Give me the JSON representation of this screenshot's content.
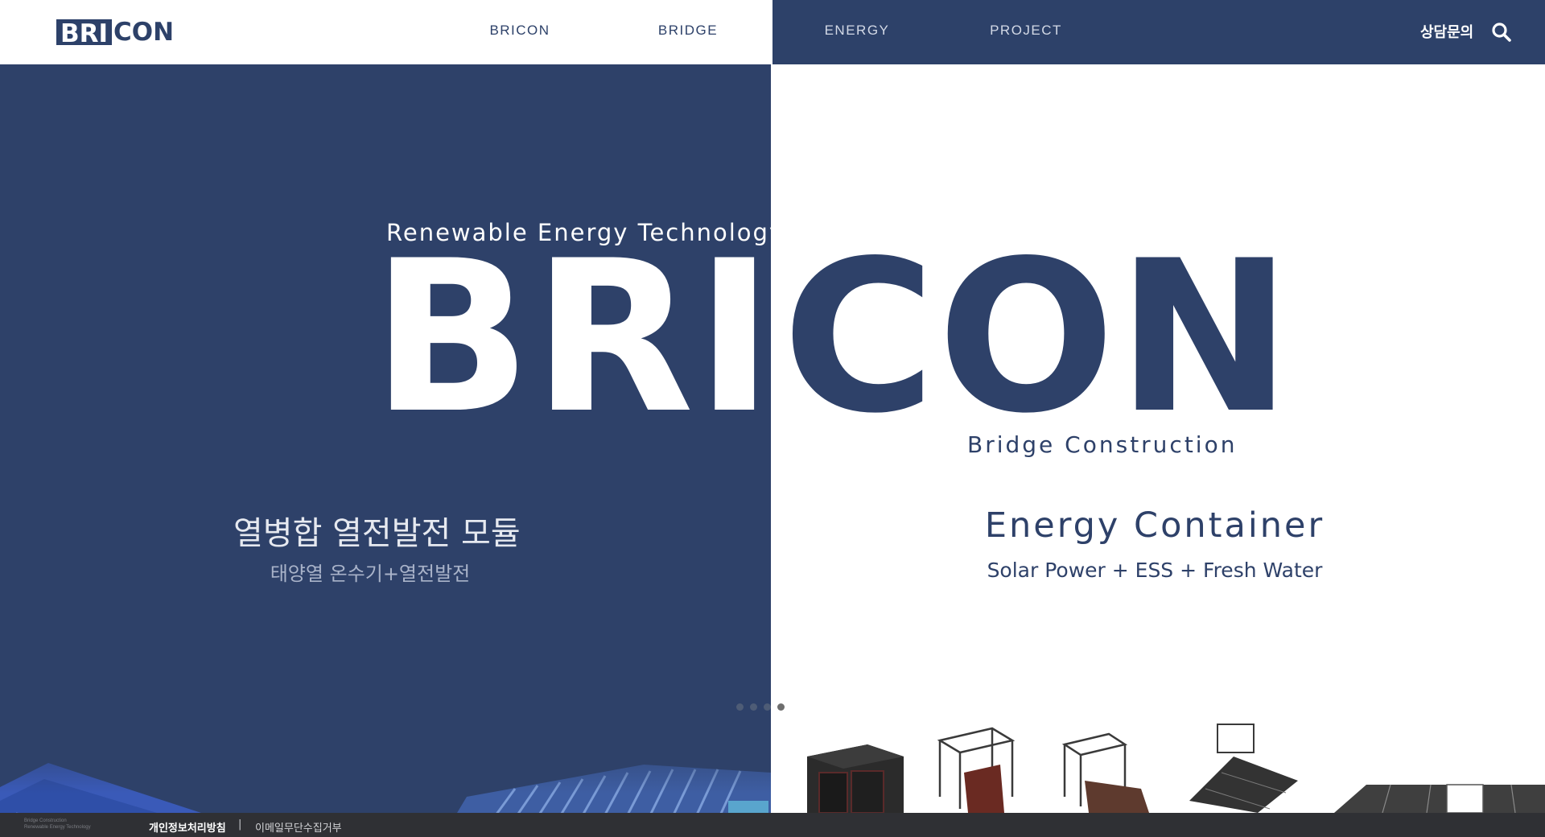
{
  "header": {
    "logo": {
      "boxed": "BRI",
      "plain": "CON"
    },
    "nav": [
      {
        "label": "BRICON"
      },
      {
        "label": "BRIDGE"
      },
      {
        "label": "ENERGY"
      },
      {
        "label": "PROJECT"
      }
    ],
    "consult_label": "상담문의",
    "search_icon": "search-icon"
  },
  "hero": {
    "tagline": "Renewable Energy Technology",
    "wordmark_left": "BRI",
    "wordmark_right": "CON",
    "subtagline": "Bridge Construction",
    "left_panel": {
      "title": "열병합 열전발전 모듈",
      "subtitle": "태양열 온수기+열전발전"
    },
    "right_panel": {
      "title": "Energy Container",
      "subtitle": "Solar Power + ESS + Fresh Water"
    },
    "slides": {
      "count": 4,
      "active_index": 3
    }
  },
  "footer": {
    "mini_lines": [
      "Bridge Construction",
      "Renewable Energy Technology"
    ],
    "privacy_label": "개인정보처리방침",
    "separator": "|",
    "email_label": "이메일무단수집거부"
  },
  "colors": {
    "brand_navy": "#2e4169",
    "footer_bg": "#2f3034"
  }
}
